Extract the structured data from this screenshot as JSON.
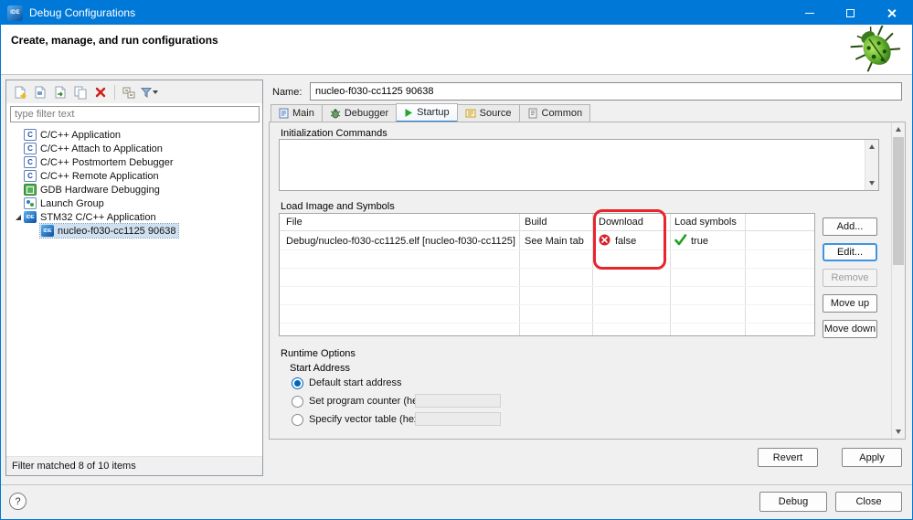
{
  "window": {
    "title": "Debug Configurations"
  },
  "banner": {
    "title": "Create, manage, and run configurations"
  },
  "left_panel": {
    "filter_placeholder": "type filter text",
    "tree_items": [
      "C/C++ Application",
      "C/C++ Attach to Application",
      "C/C++ Postmortem Debugger",
      "C/C++ Remote Application",
      "GDB Hardware Debugging",
      "Launch Group",
      "STM32 C/C++ Application",
      "nucleo-f030-cc1125 90638"
    ],
    "status": "Filter matched 8 of 10 items"
  },
  "editor": {
    "name_label": "Name:",
    "name_value": "nucleo-f030-cc1125 90638",
    "tabs": [
      "Main",
      "Debugger",
      "Startup",
      "Source",
      "Common"
    ],
    "active_tab": "Startup",
    "init_commands_label": "Initialization Commands",
    "load_image": {
      "label": "Load Image and Symbols",
      "columns": [
        "File",
        "Build",
        "Download",
        "Load symbols"
      ],
      "row": {
        "file": "Debug/nucleo-f030-cc1125.elf [nucleo-f030-cc1125]",
        "build": "See Main tab",
        "download": "false",
        "load_symbols": "true"
      },
      "buttons": {
        "add": "Add...",
        "edit": "Edit...",
        "remove": "Remove",
        "move_up": "Move up",
        "move_down": "Move down"
      }
    },
    "runtime": {
      "label": "Runtime Options",
      "start_address_label": "Start Address",
      "options": [
        "Default start address",
        "Set program counter (hex):",
        "Specify vector table (hex):"
      ],
      "selected_option": "Default start address"
    },
    "revert": "Revert",
    "apply": "Apply"
  },
  "footer": {
    "help": "?",
    "debug": "Debug",
    "close": "Close"
  },
  "icons": {
    "c_badge": "C",
    "ide_badge": "IDE"
  },
  "colors": {
    "titlebar": "#0078d7",
    "accent": "#0067b8",
    "annotation_red": "#e8252c",
    "true_green": "#1ca31c",
    "false_red": "#d8222a"
  }
}
